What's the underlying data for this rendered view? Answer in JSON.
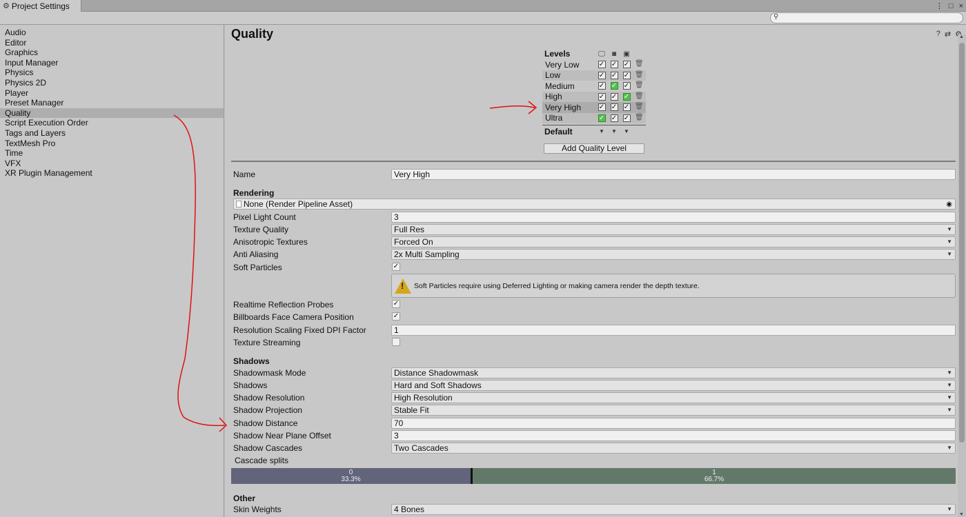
{
  "window": {
    "tab_label": "Project Settings",
    "controls": [
      "⋮",
      "□",
      "×"
    ]
  },
  "search": {
    "placeholder": ""
  },
  "sidebar": {
    "items": [
      {
        "label": "Audio"
      },
      {
        "label": "Editor"
      },
      {
        "label": "Graphics"
      },
      {
        "label": "Input Manager"
      },
      {
        "label": "Physics"
      },
      {
        "label": "Physics 2D"
      },
      {
        "label": "Player"
      },
      {
        "label": "Preset Manager"
      },
      {
        "label": "Quality",
        "selected": true
      },
      {
        "label": "Script Execution Order"
      },
      {
        "label": "Tags and Layers"
      },
      {
        "label": "TextMesh Pro"
      },
      {
        "label": "Time"
      },
      {
        "label": "VFX"
      },
      {
        "label": "XR Plugin Management"
      }
    ]
  },
  "main": {
    "title": "Quality",
    "header_icons": [
      "help-icon",
      "preset-icon",
      "settings-gear-icon"
    ]
  },
  "levels": {
    "header": "Levels",
    "platforms": [
      "desktop-icon",
      "android-icon",
      "webgl-icon"
    ],
    "rows": [
      {
        "name": "Very Low",
        "checks": [
          "on",
          "on",
          "on"
        ]
      },
      {
        "name": "Low",
        "checks": [
          "on",
          "on",
          "on"
        ]
      },
      {
        "name": "Medium",
        "checks": [
          "on",
          "green",
          "on"
        ]
      },
      {
        "name": "High",
        "checks": [
          "on",
          "on",
          "green"
        ]
      },
      {
        "name": "Very High",
        "checks": [
          "on",
          "on",
          "on"
        ],
        "selected": true
      },
      {
        "name": "Ultra",
        "checks": [
          "green",
          "on",
          "on"
        ]
      }
    ],
    "default_label": "Default",
    "add_button": "Add Quality Level"
  },
  "properties": {
    "name_label": "Name",
    "name_value": "Very High",
    "rendering_header": "Rendering",
    "pipeline_asset": "None (Render Pipeline Asset)",
    "pixel_light_count_label": "Pixel Light Count",
    "pixel_light_count_value": "3",
    "texture_quality_label": "Texture Quality",
    "texture_quality_value": "Full Res",
    "aniso_label": "Anisotropic Textures",
    "aniso_value": "Forced On",
    "anti_aliasing_label": "Anti Aliasing",
    "anti_aliasing_value": "2x Multi Sampling",
    "soft_particles_label": "Soft Particles",
    "soft_particles_checked": true,
    "soft_particles_warning": "Soft Particles require using Deferred Lighting or making camera render the depth texture.",
    "realtime_reflection_label": "Realtime Reflection Probes",
    "realtime_reflection_checked": true,
    "billboards_label": "Billboards Face Camera Position",
    "billboards_checked": true,
    "res_scaling_label": "Resolution Scaling Fixed DPI Factor",
    "res_scaling_value": "1",
    "texture_streaming_label": "Texture Streaming",
    "texture_streaming_checked": false,
    "shadows_header": "Shadows",
    "shadowmask_mode_label": "Shadowmask Mode",
    "shadowmask_mode_value": "Distance Shadowmask",
    "shadows_label": "Shadows",
    "shadows_value": "Hard and Soft Shadows",
    "shadow_resolution_label": "Shadow Resolution",
    "shadow_resolution_value": "High Resolution",
    "shadow_projection_label": "Shadow Projection",
    "shadow_projection_value": "Stable Fit",
    "shadow_distance_label": "Shadow Distance",
    "shadow_distance_value": "70",
    "shadow_near_plane_label": "Shadow Near Plane Offset",
    "shadow_near_plane_value": "3",
    "shadow_cascades_label": "Shadow Cascades",
    "shadow_cascades_value": "Two Cascades",
    "cascade_splits_label": "Cascade splits",
    "cascade_0_index": "0",
    "cascade_0_percent": "33.3%",
    "cascade_1_index": "1",
    "cascade_1_percent": "66.7%",
    "other_header": "Other",
    "skin_weights_label": "Skin Weights",
    "skin_weights_value": "4 Bones"
  },
  "colors": {
    "checkbox_green": "#53c24d",
    "annotation_red": "#e01010",
    "cascade_0": "#62647c",
    "cascade_1": "#62796a",
    "warning_yellow": "#d5a619"
  }
}
